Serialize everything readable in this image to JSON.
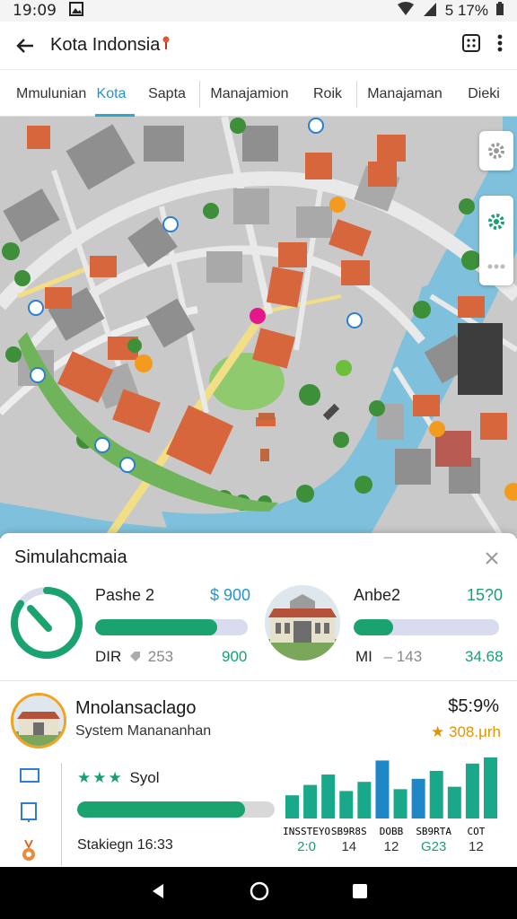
{
  "status": {
    "time": "19:09",
    "battery": "5 17%"
  },
  "app": {
    "title": "Kota Indonsia"
  },
  "tabs": [
    {
      "label": "Mmulunian"
    },
    {
      "label": "Kota"
    },
    {
      "label": "Sapta"
    },
    {
      "label": "Manajamion"
    },
    {
      "label": "Roik"
    },
    {
      "label": "Manajaman"
    },
    {
      "label": "Dieki"
    }
  ],
  "panel": {
    "title": "Simulahcmaia",
    "left_stat": {
      "label": "Pashe 2",
      "value": "$ 900",
      "progress": 0.8,
      "sub_label": "DIR",
      "sub_icon": "tag-icon",
      "sub_muted": "253",
      "sub_value": "900"
    },
    "right_stat": {
      "label": "Anbe2",
      "value": "15?0",
      "progress": 0.27,
      "sub_label": "MI",
      "sub_muted": "– 143",
      "sub_value": "34.68"
    },
    "gauge_progress": 0.85
  },
  "card2": {
    "title": "Mnolansaclago",
    "subtitle": "System Manananhan",
    "price": "$5:9%",
    "rating": "★ 308.μrh",
    "stars_label": "Syol",
    "stars_count": 3,
    "progress": 0.85,
    "footer": "Stakiegn 16:33"
  },
  "chart_data": {
    "type": "bar",
    "categories": [
      "INSSTEYO",
      "SB9R8S",
      "DOBB",
      "SB9RTA",
      "COT"
    ],
    "category_values": [
      "2:0",
      "14",
      "12",
      "G23",
      "12"
    ],
    "values": [
      0.38,
      0.55,
      0.72,
      0.45,
      0.6,
      0.95,
      0.48,
      0.65,
      0.78,
      0.52,
      0.9,
      1.0
    ],
    "colors": [
      "#1aa88a",
      "#1aa88a",
      "#1aa88a",
      "#1aa88a",
      "#1aa88a",
      "#1e88c7",
      "#1aa88a",
      "#1e88c7",
      "#1aa88a",
      "#1aa88a",
      "#1aa88a",
      "#1aa88a"
    ]
  },
  "colors": {
    "accent": "#2196c9",
    "green": "#1aa36f",
    "water": "#7fc1dd",
    "roof": "#d8663d"
  }
}
